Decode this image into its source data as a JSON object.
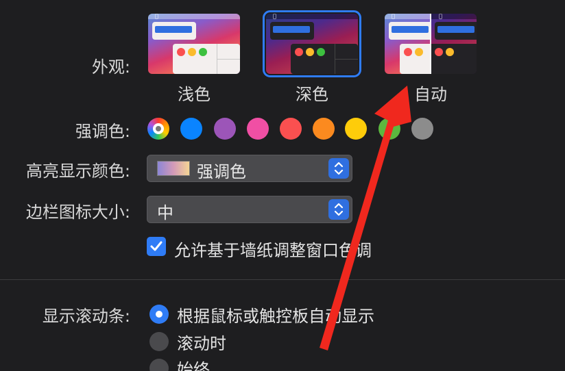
{
  "appearance": {
    "label": "外观:",
    "options": [
      {
        "caption": "浅色",
        "selected": false
      },
      {
        "caption": "深色",
        "selected": true
      },
      {
        "caption": "自动",
        "selected": false
      }
    ]
  },
  "accent": {
    "label": "强调色:",
    "colors": [
      {
        "name": "multicolor",
        "color": "multicolor"
      },
      {
        "name": "blue",
        "color": "#0a84ff"
      },
      {
        "name": "purple",
        "color": "#9c55b8"
      },
      {
        "name": "pink",
        "color": "#f04fa4"
      },
      {
        "name": "red",
        "color": "#fa5050"
      },
      {
        "name": "orange",
        "color": "#fb8a1f"
      },
      {
        "name": "yellow",
        "color": "#fecc0a"
      },
      {
        "name": "green",
        "color": "#5cb83f"
      },
      {
        "name": "graphite",
        "color": "#8c8c8c"
      }
    ]
  },
  "highlight": {
    "label": "高亮显示颜色:",
    "value": "强调色"
  },
  "sidebar_icon_size": {
    "label": "边栏图标大小:",
    "value": "中"
  },
  "wallpaper_tinting": {
    "label": "允许基于墙纸调整窗口色调",
    "checked": true
  },
  "scrollbars": {
    "label": "显示滚动条:",
    "options": [
      {
        "label": "根据鼠标或触控板自动显示",
        "selected": true
      },
      {
        "label": "滚动时",
        "selected": false
      },
      {
        "label": "始终",
        "selected": false
      }
    ]
  },
  "annotation": {
    "arrow_color": "#f0281e"
  }
}
